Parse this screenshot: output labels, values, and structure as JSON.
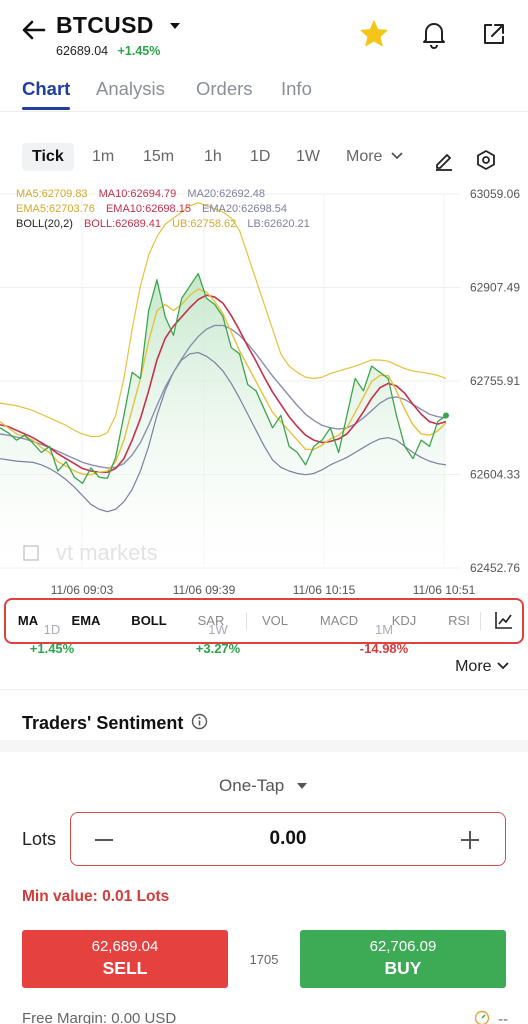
{
  "header": {
    "symbol": "BTCUSD",
    "price": "62689.04",
    "change": "+1.45%"
  },
  "tabs": [
    "Chart",
    "Analysis",
    "Orders",
    "Info"
  ],
  "timeframes": [
    "Tick",
    "1m",
    "15m",
    "1h",
    "1D",
    "1W"
  ],
  "timeframe_more": "More",
  "legend": {
    "ma5": "MA5:62709.83",
    "ma10": "MA10:62694.79",
    "ma20": "MA20:62692.48",
    "ema5": "EMA5:62703.76",
    "ema10": "EMA10:62698.15",
    "ema20": "EMA20:62698.54",
    "boll": "BOLL(20,2)",
    "boll_val": "BOLL:62689.41",
    "ub": "UB:62758.62",
    "lb": "LB:62620.21"
  },
  "watermark": "vt markets",
  "chart_data": {
    "type": "area",
    "x_ticks": [
      "11/06 09:03",
      "11/06 09:39",
      "11/06 10:15",
      "11/06 10:51"
    ],
    "y_ticks": [
      "63059.06",
      "62907.49",
      "62755.91",
      "62604.33",
      "62452.76"
    ],
    "ylim": [
      62452.76,
      63059.06
    ],
    "grid": true,
    "series": [
      {
        "name": "Price",
        "color": "#3aa64b",
        "values": [
          62680,
          62672,
          62660,
          62668,
          62655,
          62640,
          62650,
          62610,
          62625,
          62600,
          62590,
          62615,
          62600,
          62598,
          62632,
          62700,
          62770,
          62760,
          62870,
          62920,
          62860,
          62830,
          62890,
          62910,
          62930,
          62890,
          62880,
          62860,
          62810,
          62800,
          62750,
          62740,
          62710,
          62680,
          62700,
          62650,
          62640,
          62620,
          62650,
          62660,
          62680,
          62640,
          62700,
          62760,
          62740,
          62780,
          62770,
          62760,
          62700,
          62650,
          62630,
          62660,
          62650,
          62690,
          62700
        ]
      },
      {
        "name": "MA5",
        "color": "#e6c23a",
        "values": [
          62690,
          62680,
          62670,
          62666,
          62660,
          62648,
          62640,
          62625,
          62618,
          62610,
          62605,
          62604,
          62608,
          62610,
          62625,
          62660,
          62710,
          62760,
          62820,
          62870,
          62880,
          62870,
          62880,
          62895,
          62905,
          62900,
          62885,
          62865,
          62835,
          62805,
          62780,
          62755,
          62730,
          62705,
          62690,
          62675,
          62660,
          62645,
          62645,
          62652,
          62662,
          62668,
          62680,
          62705,
          62730,
          62755,
          62765,
          62765,
          62740,
          62710,
          62685,
          62670,
          62668,
          62675,
          62688
        ]
      },
      {
        "name": "MA10",
        "color": "#c8304b",
        "values": [
          62685,
          62682,
          62676,
          62670,
          62664,
          62656,
          62648,
          62638,
          62630,
          62622,
          62614,
          62610,
          62608,
          62608,
          62614,
          62630,
          62660,
          62695,
          62740,
          62790,
          62825,
          62845,
          62860,
          62875,
          62888,
          62895,
          62892,
          62882,
          62862,
          62838,
          62812,
          62788,
          62762,
          62738,
          62718,
          62698,
          62682,
          62668,
          62660,
          62656,
          62658,
          62662,
          62670,
          62686,
          62706,
          62728,
          62745,
          62752,
          62748,
          62736,
          62718,
          62702,
          62690,
          62686,
          62690
        ]
      },
      {
        "name": "EMA20",
        "color": "#8a8fb0",
        "values": [
          62670,
          62668,
          62665,
          62662,
          62658,
          62653,
          62648,
          62642,
          62636,
          62630,
          62624,
          62620,
          62617,
          62615,
          62616,
          62622,
          62636,
          62656,
          62684,
          62716,
          62746,
          62770,
          62792,
          62812,
          62828,
          62840,
          62846,
          62846,
          62840,
          62830,
          62816,
          62800,
          62782,
          62764,
          62748,
          62732,
          62716,
          62702,
          62692,
          62684,
          62680,
          62678,
          62680,
          62686,
          62696,
          62708,
          62720,
          62728,
          62730,
          62726,
          62718,
          62710,
          62702,
          62698,
          62696
        ]
      },
      {
        "name": "UB",
        "color": "#e6c23a",
        "values": [
          62720,
          62718,
          62716,
          62712,
          62708,
          62702,
          62696,
          62690,
          62684,
          62676,
          62670,
          62666,
          62666,
          62672,
          62700,
          62760,
          62840,
          62910,
          62960,
          62990,
          63010,
          63020,
          63030,
          63040,
          63045,
          63040,
          63035,
          63030,
          63020,
          63000,
          62960,
          62920,
          62880,
          62840,
          62800,
          62780,
          62770,
          62762,
          62760,
          62762,
          62768,
          62772,
          62776,
          62780,
          62785,
          62790,
          62790,
          62788,
          62782,
          62776,
          62772,
          62770,
          62768,
          62765,
          62760
        ]
      },
      {
        "name": "LB",
        "color": "#7d7fa0",
        "values": [
          62630,
          62628,
          62626,
          62625,
          62624,
          62620,
          62614,
          62606,
          62596,
          62584,
          62570,
          62556,
          62548,
          62544,
          62548,
          62560,
          62580,
          62610,
          62650,
          62700,
          62740,
          62770,
          62790,
          62800,
          62802,
          62796,
          62786,
          62772,
          62752,
          62728,
          62702,
          62676,
          62650,
          62628,
          62616,
          62610,
          62606,
          62604,
          62606,
          62612,
          62620,
          62626,
          62632,
          62640,
          62648,
          62656,
          62662,
          62664,
          62660,
          62650,
          62640,
          62632,
          62626,
          62622,
          62620
        ]
      }
    ]
  },
  "indicators": [
    "MA",
    "EMA",
    "BOLL",
    "SAR",
    "VOL",
    "MACD",
    "KDJ",
    "RSI"
  ],
  "performance": [
    {
      "label": "1D",
      "value": "+1.45%",
      "color": "#2aa54a"
    },
    {
      "label": "1W",
      "value": "+3.27%",
      "color": "#2aa54a"
    },
    {
      "label": "1M",
      "value": "-14.98%",
      "color": "#d63b3b"
    }
  ],
  "perf_more": "More",
  "sentiment_title": "Traders' Sentiment",
  "order": {
    "type": "One-Tap",
    "lots_label": "Lots",
    "lots_value": "0.00",
    "min_value": "Min value: 0.01 Lots",
    "sell_price": "62,689.04",
    "sell_label": "SELL",
    "buy_price": "62,706.09",
    "buy_label": "BUY",
    "spread": "1705",
    "free_margin": "Free Margin: 0.00 USD",
    "margin_right": "--"
  }
}
